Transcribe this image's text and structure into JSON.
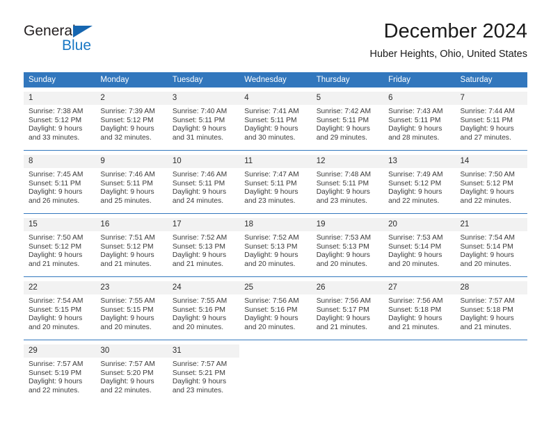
{
  "brand": {
    "word_one": "General",
    "word_two": "Blue",
    "triangle_icon": "blue-triangle-icon",
    "accent_color": "#1877c4",
    "header_color": "#3277bd"
  },
  "header": {
    "month_title": "December 2024",
    "location": "Huber Heights, Ohio, United States"
  },
  "calendar": {
    "weekday_headers": [
      "Sunday",
      "Monday",
      "Tuesday",
      "Wednesday",
      "Thursday",
      "Friday",
      "Saturday"
    ],
    "weeks": [
      [
        {
          "day": "1",
          "sunrise": "Sunrise: 7:38 AM",
          "sunset": "Sunset: 5:12 PM",
          "daylight_line1": "Daylight: 9 hours",
          "daylight_line2": "and 33 minutes."
        },
        {
          "day": "2",
          "sunrise": "Sunrise: 7:39 AM",
          "sunset": "Sunset: 5:12 PM",
          "daylight_line1": "Daylight: 9 hours",
          "daylight_line2": "and 32 minutes."
        },
        {
          "day": "3",
          "sunrise": "Sunrise: 7:40 AM",
          "sunset": "Sunset: 5:11 PM",
          "daylight_line1": "Daylight: 9 hours",
          "daylight_line2": "and 31 minutes."
        },
        {
          "day": "4",
          "sunrise": "Sunrise: 7:41 AM",
          "sunset": "Sunset: 5:11 PM",
          "daylight_line1": "Daylight: 9 hours",
          "daylight_line2": "and 30 minutes."
        },
        {
          "day": "5",
          "sunrise": "Sunrise: 7:42 AM",
          "sunset": "Sunset: 5:11 PM",
          "daylight_line1": "Daylight: 9 hours",
          "daylight_line2": "and 29 minutes."
        },
        {
          "day": "6",
          "sunrise": "Sunrise: 7:43 AM",
          "sunset": "Sunset: 5:11 PM",
          "daylight_line1": "Daylight: 9 hours",
          "daylight_line2": "and 28 minutes."
        },
        {
          "day": "7",
          "sunrise": "Sunrise: 7:44 AM",
          "sunset": "Sunset: 5:11 PM",
          "daylight_line1": "Daylight: 9 hours",
          "daylight_line2": "and 27 minutes."
        }
      ],
      [
        {
          "day": "8",
          "sunrise": "Sunrise: 7:45 AM",
          "sunset": "Sunset: 5:11 PM",
          "daylight_line1": "Daylight: 9 hours",
          "daylight_line2": "and 26 minutes."
        },
        {
          "day": "9",
          "sunrise": "Sunrise: 7:46 AM",
          "sunset": "Sunset: 5:11 PM",
          "daylight_line1": "Daylight: 9 hours",
          "daylight_line2": "and 25 minutes."
        },
        {
          "day": "10",
          "sunrise": "Sunrise: 7:46 AM",
          "sunset": "Sunset: 5:11 PM",
          "daylight_line1": "Daylight: 9 hours",
          "daylight_line2": "and 24 minutes."
        },
        {
          "day": "11",
          "sunrise": "Sunrise: 7:47 AM",
          "sunset": "Sunset: 5:11 PM",
          "daylight_line1": "Daylight: 9 hours",
          "daylight_line2": "and 23 minutes."
        },
        {
          "day": "12",
          "sunrise": "Sunrise: 7:48 AM",
          "sunset": "Sunset: 5:11 PM",
          "daylight_line1": "Daylight: 9 hours",
          "daylight_line2": "and 23 minutes."
        },
        {
          "day": "13",
          "sunrise": "Sunrise: 7:49 AM",
          "sunset": "Sunset: 5:12 PM",
          "daylight_line1": "Daylight: 9 hours",
          "daylight_line2": "and 22 minutes."
        },
        {
          "day": "14",
          "sunrise": "Sunrise: 7:50 AM",
          "sunset": "Sunset: 5:12 PM",
          "daylight_line1": "Daylight: 9 hours",
          "daylight_line2": "and 22 minutes."
        }
      ],
      [
        {
          "day": "15",
          "sunrise": "Sunrise: 7:50 AM",
          "sunset": "Sunset: 5:12 PM",
          "daylight_line1": "Daylight: 9 hours",
          "daylight_line2": "and 21 minutes."
        },
        {
          "day": "16",
          "sunrise": "Sunrise: 7:51 AM",
          "sunset": "Sunset: 5:12 PM",
          "daylight_line1": "Daylight: 9 hours",
          "daylight_line2": "and 21 minutes."
        },
        {
          "day": "17",
          "sunrise": "Sunrise: 7:52 AM",
          "sunset": "Sunset: 5:13 PM",
          "daylight_line1": "Daylight: 9 hours",
          "daylight_line2": "and 21 minutes."
        },
        {
          "day": "18",
          "sunrise": "Sunrise: 7:52 AM",
          "sunset": "Sunset: 5:13 PM",
          "daylight_line1": "Daylight: 9 hours",
          "daylight_line2": "and 20 minutes."
        },
        {
          "day": "19",
          "sunrise": "Sunrise: 7:53 AM",
          "sunset": "Sunset: 5:13 PM",
          "daylight_line1": "Daylight: 9 hours",
          "daylight_line2": "and 20 minutes."
        },
        {
          "day": "20",
          "sunrise": "Sunrise: 7:53 AM",
          "sunset": "Sunset: 5:14 PM",
          "daylight_line1": "Daylight: 9 hours",
          "daylight_line2": "and 20 minutes."
        },
        {
          "day": "21",
          "sunrise": "Sunrise: 7:54 AM",
          "sunset": "Sunset: 5:14 PM",
          "daylight_line1": "Daylight: 9 hours",
          "daylight_line2": "and 20 minutes."
        }
      ],
      [
        {
          "day": "22",
          "sunrise": "Sunrise: 7:54 AM",
          "sunset": "Sunset: 5:15 PM",
          "daylight_line1": "Daylight: 9 hours",
          "daylight_line2": "and 20 minutes."
        },
        {
          "day": "23",
          "sunrise": "Sunrise: 7:55 AM",
          "sunset": "Sunset: 5:15 PM",
          "daylight_line1": "Daylight: 9 hours",
          "daylight_line2": "and 20 minutes."
        },
        {
          "day": "24",
          "sunrise": "Sunrise: 7:55 AM",
          "sunset": "Sunset: 5:16 PM",
          "daylight_line1": "Daylight: 9 hours",
          "daylight_line2": "and 20 minutes."
        },
        {
          "day": "25",
          "sunrise": "Sunrise: 7:56 AM",
          "sunset": "Sunset: 5:16 PM",
          "daylight_line1": "Daylight: 9 hours",
          "daylight_line2": "and 20 minutes."
        },
        {
          "day": "26",
          "sunrise": "Sunrise: 7:56 AM",
          "sunset": "Sunset: 5:17 PM",
          "daylight_line1": "Daylight: 9 hours",
          "daylight_line2": "and 21 minutes."
        },
        {
          "day": "27",
          "sunrise": "Sunrise: 7:56 AM",
          "sunset": "Sunset: 5:18 PM",
          "daylight_line1": "Daylight: 9 hours",
          "daylight_line2": "and 21 minutes."
        },
        {
          "day": "28",
          "sunrise": "Sunrise: 7:57 AM",
          "sunset": "Sunset: 5:18 PM",
          "daylight_line1": "Daylight: 9 hours",
          "daylight_line2": "and 21 minutes."
        }
      ],
      [
        {
          "day": "29",
          "sunrise": "Sunrise: 7:57 AM",
          "sunset": "Sunset: 5:19 PM",
          "daylight_line1": "Daylight: 9 hours",
          "daylight_line2": "and 22 minutes."
        },
        {
          "day": "30",
          "sunrise": "Sunrise: 7:57 AM",
          "sunset": "Sunset: 5:20 PM",
          "daylight_line1": "Daylight: 9 hours",
          "daylight_line2": "and 22 minutes."
        },
        {
          "day": "31",
          "sunrise": "Sunrise: 7:57 AM",
          "sunset": "Sunset: 5:21 PM",
          "daylight_line1": "Daylight: 9 hours",
          "daylight_line2": "and 23 minutes."
        },
        {
          "day": "",
          "sunrise": "",
          "sunset": "",
          "daylight_line1": "",
          "daylight_line2": ""
        },
        {
          "day": "",
          "sunrise": "",
          "sunset": "",
          "daylight_line1": "",
          "daylight_line2": ""
        },
        {
          "day": "",
          "sunrise": "",
          "sunset": "",
          "daylight_line1": "",
          "daylight_line2": ""
        },
        {
          "day": "",
          "sunrise": "",
          "sunset": "",
          "daylight_line1": "",
          "daylight_line2": ""
        }
      ]
    ]
  }
}
